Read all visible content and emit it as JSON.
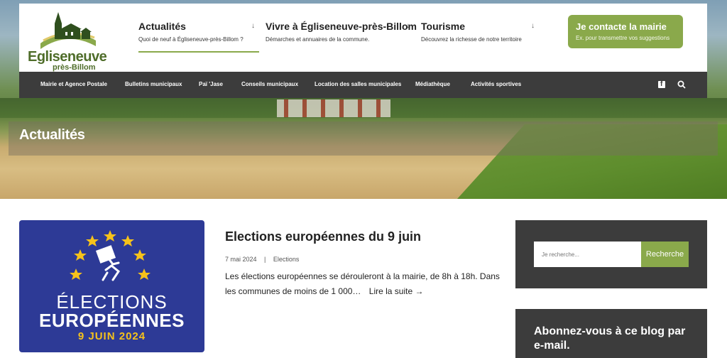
{
  "brand": {
    "name_line1": "Egliseneuve",
    "name_line2": "près-Billom"
  },
  "top_nav": [
    {
      "title": "Actualités",
      "subtitle": "Quoi de neuf à Égliseneuve-près-Billom ?"
    },
    {
      "title": "Vivre à Égliseneuve-près-Billom",
      "subtitle": "Démarches et annuaires de la commune."
    },
    {
      "title": "Tourisme",
      "subtitle": "Découvrez la richesse de notre territoire"
    }
  ],
  "contact_button": {
    "title": "Je contacte la mairie",
    "subtitle": "Ex. pour transmettre vos suggestions"
  },
  "menu": [
    "Mairie et Agence Postale",
    "Bulletins municipaux",
    "Paï 'Jase",
    "Conseils municipaux",
    "Location des salles municipales",
    "Médiathèque",
    "Activités sportives"
  ],
  "page_title": "Actualités",
  "article": {
    "thumbnail": {
      "line1": "ÉLECTIONS",
      "line2": "EUROPÉENNES",
      "line3": "9 JUIN 2024"
    },
    "title": "Elections européennes du 9 juin",
    "date": "7 mai 2024",
    "separator": "|",
    "category": "Elections",
    "excerpt": "Les élections européennes se dérouleront à la mairie, de 8h à 18h. Dans les communes de moins de 1 000…",
    "read_more": "Lire la suite →"
  },
  "sidebar": {
    "search_placeholder": "Je recherche...",
    "search_button": "Recherche",
    "subscribe_title": "Abonnez-vous à ce blog par e-mail."
  },
  "colors": {
    "accent_green": "#8aa94b",
    "dark_bar": "#3c3c3c",
    "eu_blue": "#2d3a96",
    "eu_yellow": "#f6c21b"
  }
}
